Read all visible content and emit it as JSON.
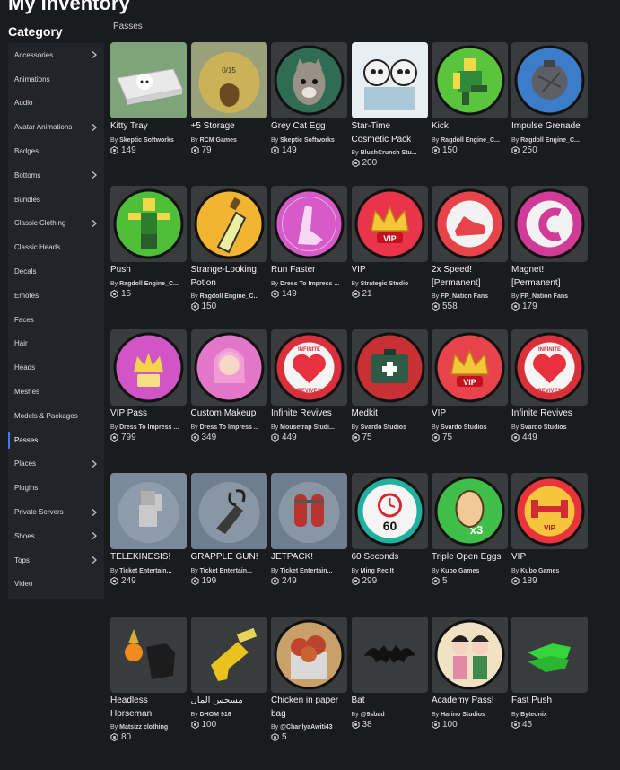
{
  "header": {
    "title": "My Inventory"
  },
  "sidebar": {
    "heading": "Category",
    "items": [
      {
        "label": "Accessories",
        "chevron": true
      },
      {
        "label": "Animations",
        "chevron": false
      },
      {
        "label": "Audio",
        "chevron": false
      },
      {
        "label": "Avatar Animations",
        "chevron": true
      },
      {
        "label": "Badges",
        "chevron": false
      },
      {
        "label": "Bottoms",
        "chevron": true
      },
      {
        "label": "Bundles",
        "chevron": false
      },
      {
        "label": "Classic Clothing",
        "chevron": true
      },
      {
        "label": "Classic Heads",
        "chevron": false
      },
      {
        "label": "Decals",
        "chevron": false
      },
      {
        "label": "Emotes",
        "chevron": false
      },
      {
        "label": "Faces",
        "chevron": false
      },
      {
        "label": "Hair",
        "chevron": false
      },
      {
        "label": "Heads",
        "chevron": false
      },
      {
        "label": "Meshes",
        "chevron": false
      },
      {
        "label": "Models & Packages",
        "chevron": false
      },
      {
        "label": "Passes",
        "chevron": false,
        "active": true
      },
      {
        "label": "Places",
        "chevron": true
      },
      {
        "label": "Plugins",
        "chevron": false
      },
      {
        "label": "Private Servers",
        "chevron": true
      },
      {
        "label": "Shoes",
        "chevron": true
      },
      {
        "label": "Tops",
        "chevron": true
      },
      {
        "label": "Video",
        "chevron": false
      }
    ]
  },
  "main": {
    "section_label": "Passes",
    "items": [
      {
        "name": "Kitty Tray",
        "by": "By",
        "creator": "Skeptic Softworks",
        "price": "149",
        "icon": "kitty-tray-icon",
        "bg": "#7fa37a",
        "fg": "#f2f2f2"
      },
      {
        "name": "+5 Storage",
        "by": "By",
        "creator": "RCM Games",
        "price": "79",
        "icon": "storage-bag-icon",
        "bg": "#c9b257",
        "fg": "#6b4a22"
      },
      {
        "name": "Grey Cat Egg",
        "by": "By",
        "creator": "Skeptic Softworks",
        "price": "149",
        "icon": "cat-egg-icon",
        "bg": "#2f6b55",
        "fg": "#9a9186"
      },
      {
        "name": "Star-Time Cosmetic Pack",
        "by": "By",
        "creator": "BlushCrunch Stu...",
        "price": "200",
        "icon": "cosmetic-pack-icon",
        "bg": "#8fc6e0",
        "fg": "#f4f4f4"
      },
      {
        "name": "Kick",
        "by": "By",
        "creator": "Ragdoll Engine_C...",
        "price": "150",
        "icon": "kick-icon",
        "bg": "#5ac43c",
        "fg": "#2f8a3a"
      },
      {
        "name": "Impulse Grenade",
        "by": "By",
        "creator": "Ragdoll Engine_C...",
        "price": "250",
        "icon": "grenade-icon",
        "bg": "#3b7dc9",
        "fg": "#5d5f66"
      },
      {
        "name": "Push",
        "by": "By",
        "creator": "Ragdoll Engine_C...",
        "price": "15",
        "icon": "push-icon",
        "bg": "#4fbf3a",
        "fg": "#2c7d2e"
      },
      {
        "name": "Strange-Looking Potion",
        "by": "By",
        "creator": "Ragdoll Engine_C...",
        "price": "150",
        "icon": "potion-icon",
        "bg": "#f1b531",
        "fg": "#eaf0a0"
      },
      {
        "name": "Run Faster",
        "by": "By",
        "creator": "Dress To Impress ...",
        "price": "149",
        "icon": "run-faster-icon",
        "bg": "#d65ac8",
        "fg": "#f7d8f2"
      },
      {
        "name": "VIP",
        "by": "By",
        "creator": "Strategic Studio",
        "price": "21",
        "icon": "vip-crown-icon",
        "bg": "#e9344a",
        "fg": "#f5c63b"
      },
      {
        "name": "2x Speed! [Permanent]",
        "by": "By",
        "creator": "FP_Nation Fans",
        "price": "558",
        "icon": "speed-shoe-icon",
        "bg": "#e8434b",
        "fg": "#ffffff"
      },
      {
        "name": "Magnet! [Permanent]",
        "by": "By",
        "creator": "FP_Nation Fans",
        "price": "179",
        "icon": "magnet-icon",
        "bg": "#cf3b97",
        "fg": "#ffffff"
      },
      {
        "name": "VIP Pass",
        "by": "By",
        "creator": "Dress To Impress ...",
        "price": "799",
        "icon": "vip-pass-icon",
        "bg": "#d255c8",
        "fg": "#f5d34a"
      },
      {
        "name": "Custom Makeup",
        "by": "By",
        "creator": "Dress To Impress ...",
        "price": "349",
        "icon": "makeup-icon",
        "bg": "#e276c8",
        "fg": "#f2c0e8"
      },
      {
        "name": "Infinite Revives",
        "by": "By",
        "creator": "Mousetrap Studi...",
        "price": "449",
        "icon": "infinite-revives-icon",
        "bg": "#d9303b",
        "fg": "#ffffff"
      },
      {
        "name": "Medkit",
        "by": "By",
        "creator": "Svardo Studios",
        "price": "75",
        "icon": "medkit-icon",
        "bg": "#c93034",
        "fg": "#2f5a45"
      },
      {
        "name": "VIP",
        "by": "By",
        "creator": "Svardo Studios",
        "price": "75",
        "icon": "vip-crown-icon",
        "bg": "#e8434b",
        "fg": "#f5c63b"
      },
      {
        "name": "Infinite Revives",
        "by": "By",
        "creator": "Svardo Studios",
        "price": "449",
        "icon": "infinite-revives-icon",
        "bg": "#d9303b",
        "fg": "#ffffff"
      },
      {
        "name": "TELEKINESIS!",
        "by": "By",
        "creator": "Ticket Entertain...",
        "price": "249",
        "icon": "telekinesis-icon",
        "bg": "#7b8a9a",
        "fg": "#c9c9c9"
      },
      {
        "name": "GRAPPLE GUN!",
        "by": "By",
        "creator": "Ticket Entertain...",
        "price": "199",
        "icon": "grapple-gun-icon",
        "bg": "#6f7e8f",
        "fg": "#3a3a3a"
      },
      {
        "name": "JETPACK!",
        "by": "By",
        "creator": "Ticket Entertain...",
        "price": "249",
        "icon": "jetpack-icon",
        "bg": "#6f7e8f",
        "fg": "#b8342f"
      },
      {
        "name": "60 Seconds",
        "by": "By",
        "creator": "Ming Rec It",
        "price": "299",
        "icon": "timer-icon",
        "bg": "#1fb0a0",
        "fg": "#d8262e"
      },
      {
        "name": "Triple Open Eggs",
        "by": "By",
        "creator": "Kubo Games",
        "price": "5",
        "icon": "egg-icon",
        "bg": "#3fbf4a",
        "fg": "#f0c994"
      },
      {
        "name": "VIP",
        "by": "By",
        "creator": "Kubo Games",
        "price": "189",
        "icon": "vip-dumbbell-icon",
        "bg": "#e8343a",
        "fg": "#f5c63b"
      },
      {
        "name": "Headless Horseman",
        "by": "By",
        "creator": "Matsizz clothing",
        "price": "80",
        "icon": "headless-horseman-icon",
        "bg": "#393b3d",
        "fg": "#1a1a1a"
      },
      {
        "name": "مسحس المال",
        "by": "By",
        "creator": "DHOM 916",
        "price": "100",
        "icon": "money-gun-icon",
        "bg": "#393b3d",
        "fg": "#e9c21b"
      },
      {
        "name": "Chicken in paper bag",
        "by": "By",
        "creator": "@ChanlyaAwiti43",
        "price": "5",
        "icon": "chicken-bag-icon",
        "bg": "#c9a06a",
        "fg": "#c2442f"
      },
      {
        "name": "Bat",
        "by": "By",
        "creator": "@9sbad",
        "price": "38",
        "icon": "bat-icon",
        "bg": "#393b3d",
        "fg": "#111111"
      },
      {
        "name": "Academy Pass!",
        "by": "By",
        "creator": "Harino Studios",
        "price": "100",
        "icon": "academy-pass-icon",
        "bg": "#f0e2c2",
        "fg": "#3e8a4a"
      },
      {
        "name": "Fast Push",
        "by": "By",
        "creator": "Byteonix",
        "price": "45",
        "icon": "fast-push-icon",
        "bg": "#393b3d",
        "fg": "#35d43a"
      }
    ]
  },
  "colors": {
    "background": "#1a1b1f",
    "sidebar": "#232429",
    "thumb": "#393b3d",
    "accent": "#3a7bfd"
  }
}
